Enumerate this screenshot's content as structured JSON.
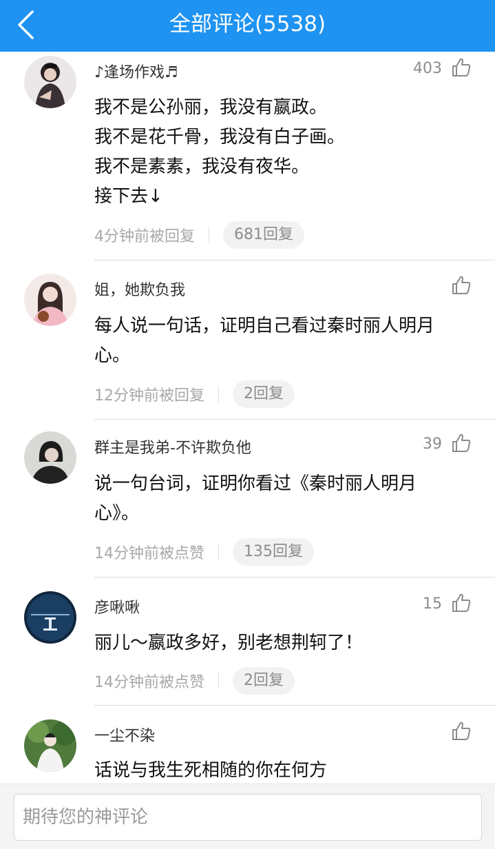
{
  "header": {
    "title": "全部评论(5538)"
  },
  "comments": [
    {
      "username": "♪逢场作戏♬",
      "likes": "403",
      "lines": [
        "我不是公孙丽，我没有嬴政。",
        "我不是花千骨，我没有白子画。",
        "我不是素素，我没有夜华。",
        "接下去↓"
      ],
      "time": "4分钟前被回复",
      "replies": "681回复"
    },
    {
      "username": "姐，她欺负我",
      "likes": "",
      "lines": [
        "每人说一句话，证明自己看过秦时丽人明月",
        "心。"
      ],
      "time": "12分钟前被回复",
      "replies": "2回复"
    },
    {
      "username": "群主是我弟-不许欺负他",
      "likes": "39",
      "lines": [
        "说一句台词，证明你看过《秦时丽人明月",
        "心》。"
      ],
      "time": "14分钟前被点赞",
      "replies": "135回复"
    },
    {
      "username": "彦啾啾",
      "likes": "15",
      "lines": [
        "丽儿～嬴政多好，别老想荆轲了！"
      ],
      "time": "14分钟前被点赞",
      "replies": "2回复"
    },
    {
      "username": "一尘不染",
      "likes": "",
      "lines": [
        "话说与我生死相随的你在何方"
      ],
      "time": "",
      "replies": ""
    }
  ],
  "footer": {
    "placeholder": "期待您的神评论"
  },
  "colors": {
    "header_bg": "#1e93f2",
    "text_primary": "#111111",
    "text_secondary": "#8c8c8c"
  },
  "icons": {
    "back": "chevron-left-icon",
    "like": "thumbs-up-icon"
  }
}
